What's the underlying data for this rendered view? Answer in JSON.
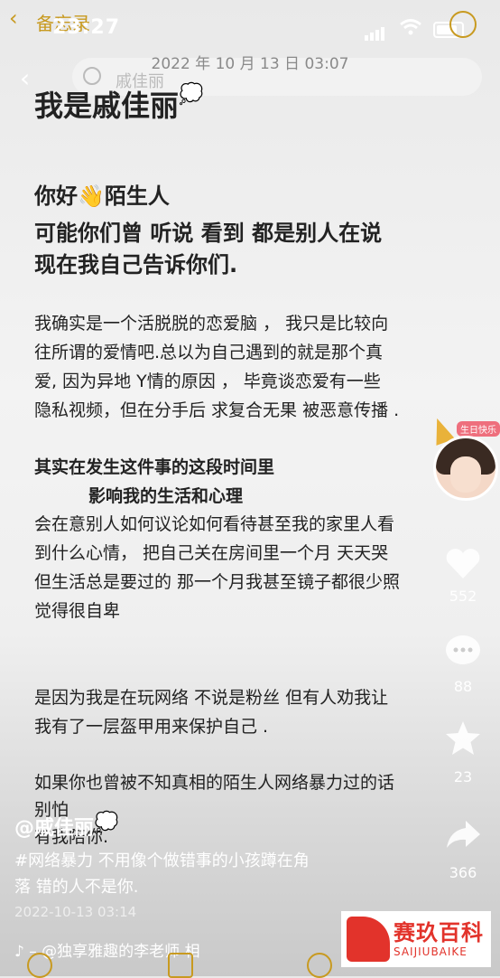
{
  "status_bar": {
    "back_label": "备忘录",
    "time": "23:27"
  },
  "header": {
    "date": "2022 年 10 月 13 日 03:07",
    "search_placeholder": "戚佳丽"
  },
  "note": {
    "title": "我是戚佳丽",
    "intro_lines": [
      "你好👋陌生人",
      "可能你们曾 听说 看到 都是别人在说",
      "现在我自己告诉你们."
    ],
    "para1_lines": [
      "我确实是一个活脱脱的恋爱脑 ， 我只是比较向",
      "往所谓的爱情吧.总以为自己遇到的就是那个真",
      "爱, 因为异地 Y情的原因 ， 毕竟谈恋爱有一些",
      "隐私视频，但在分手后 求复合无果 被恶意传播 ."
    ],
    "sub_heading_1": "其实在发生这件事的这段时间里",
    "sub_heading_2": "影响我的生活和心理",
    "para2_lines": [
      "会在意别人如何议论如何看待甚至我的家里人看",
      "到什么心情， 把自己关在房间里一个月 天天哭",
      "但生活总是要过的 那一个月我甚至镜子都很少照",
      "觉得很自卑"
    ],
    "para3_lines": [
      "是因为我是在玩网络 不说是粉丝 但有人劝我让",
      "我有了一层盔甲用来保护自己 ."
    ],
    "para4_lines": [
      "如果你也曾被不知真相的陌生人网络暴力过的话",
      "别怕",
      "有我陪你."
    ]
  },
  "sidebar": {
    "badge_text": "生日快乐",
    "like_count": "552",
    "comment_count": "88",
    "favorite_count": "23",
    "share_count": "366"
  },
  "post": {
    "author": "@戚佳丽",
    "caption_line1": "#网络暴力 不用像个做错事的小孩蹲在角",
    "caption_line2": "落 错的人不是你.",
    "date": "2022-10-13 03:14",
    "music": "♪ – @独享雅趣的李老师   相"
  },
  "watermark": {
    "brand_cn": "赛玖百科",
    "brand_en": "SAIJIUBAIKE"
  },
  "colors": {
    "accent": "#c89a20",
    "brand_red": "#e2332b"
  }
}
